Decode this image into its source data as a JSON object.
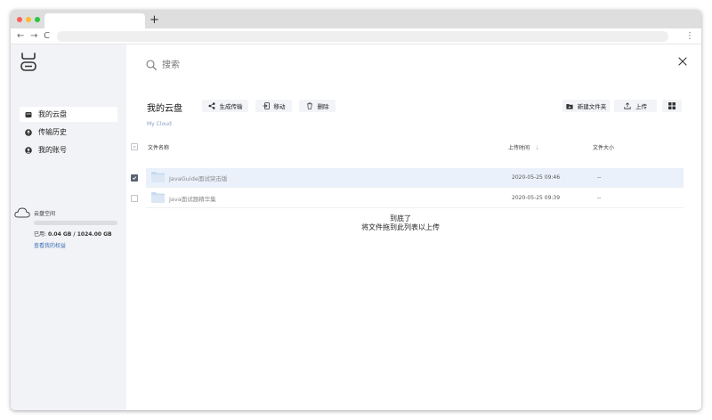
{
  "browser": {
    "new_tab_label": "+",
    "back_label": "←",
    "forward_label": "→",
    "reload_label": "C",
    "menu_label": "⋮"
  },
  "sidebar": {
    "items": [
      {
        "label": "我的云盘",
        "icon": "drive-icon",
        "active": true
      },
      {
        "label": "传输历史",
        "icon": "upload-circle-icon",
        "active": false
      },
      {
        "label": "我的账号",
        "icon": "account-icon",
        "active": false
      }
    ],
    "storage": {
      "title": "云盘空间",
      "used_prefix": "已用:",
      "used_value": "0.04 GB / 1024.00 GB",
      "used_fraction": 4e-05,
      "rights_link": "查看我的权益"
    }
  },
  "search": {
    "placeholder": "搜索"
  },
  "page": {
    "title": "我的云盘",
    "subtitle": "My Cloud"
  },
  "toolbar": {
    "generate_transfer": "生成传输",
    "move": "移动",
    "delete": "删除",
    "new_folder": "新建文件夹",
    "upload": "上传"
  },
  "table": {
    "columns": {
      "name": "文件名称",
      "upload_time": "上传时间",
      "sort_indicator": "↓",
      "size": "文件大小"
    },
    "rows": [
      {
        "name": "JavaGuide面试突击版",
        "time": "2020-05-25 09:46",
        "size": "--",
        "checked": true
      },
      {
        "name": "Java面试题精华集",
        "time": "2020-05-25 09:39",
        "size": "--",
        "checked": false
      }
    ],
    "end_title": "到底了",
    "end_hint": "将文件拖到此列表以上传"
  },
  "colors": {
    "accent_link": "#3a6fb5",
    "selected_row": "#eaf1fb",
    "sidebar_bg": "#f2f3f6"
  }
}
